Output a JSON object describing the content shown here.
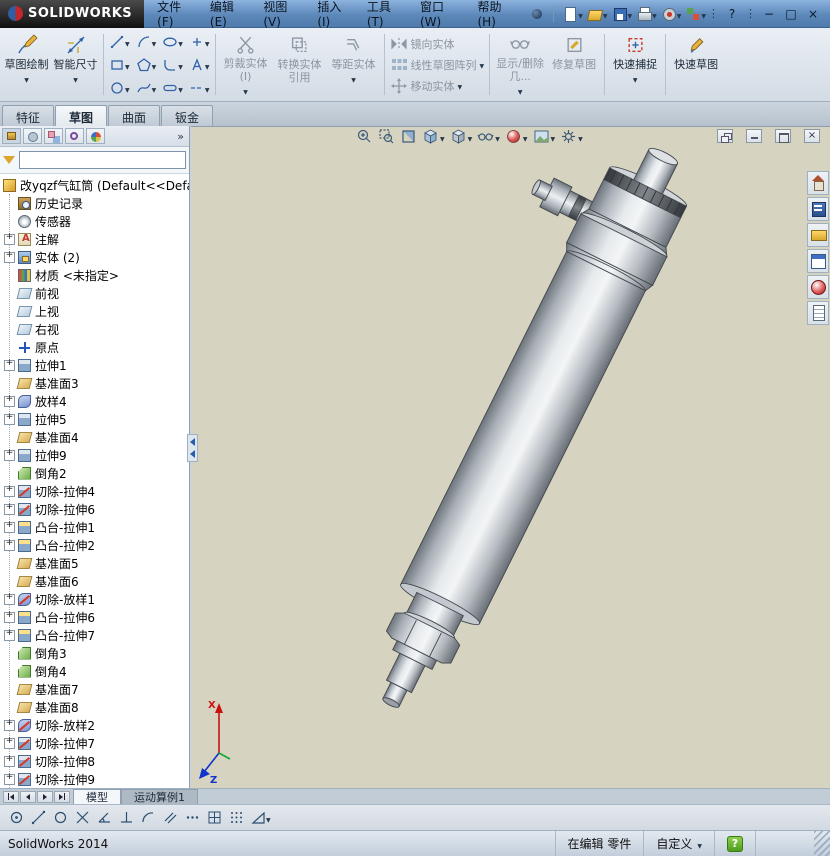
{
  "titlebar": {
    "brand": "SOLIDWORKS",
    "menus": [
      "文件(F)",
      "编辑(E)",
      "视图(V)",
      "插入(I)",
      "工具(T)",
      "窗口(W)",
      "帮助(H)"
    ]
  },
  "glyphs": {
    "down": "▼",
    "chevrons": "»",
    "plus": "+",
    "min": "−",
    "max": "□",
    "close": "×",
    "help": "?"
  },
  "ribbon": {
    "sketch": "草图绘制",
    "smart_dimension": "智能尺寸",
    "trim": "剪裁实体(I)",
    "convert": "转换实体引用",
    "offset": "等距实体",
    "mirror": "镜向实体",
    "linear_pattern": "线性草图阵列",
    "move": "移动实体",
    "display_delete": "显示/删除几...",
    "repair": "修复草图",
    "quick_snaps": "快速捕捉",
    "rapid_sketch": "快速草图"
  },
  "command_tabs": [
    "特征",
    "草图",
    "曲面",
    "钣金"
  ],
  "panel": {
    "filter_value": ""
  },
  "tree": {
    "root": "改yqzf气缸筒 (Default<<Defa",
    "items": [
      {
        "label": "历史记录",
        "icon": "history",
        "plus": false
      },
      {
        "label": "传感器",
        "icon": "sensors",
        "plus": false
      },
      {
        "label": "注解",
        "icon": "annotations",
        "plus": true
      },
      {
        "label": "实体 (2)",
        "icon": "solid-bodies",
        "plus": true
      },
      {
        "label": "材质 <未指定>",
        "icon": "material",
        "plus": false
      },
      {
        "label": "前视",
        "icon": "ref-plane",
        "plus": false
      },
      {
        "label": "上视",
        "icon": "ref-plane",
        "plus": false
      },
      {
        "label": "右视",
        "icon": "ref-plane",
        "plus": false
      },
      {
        "label": "原点",
        "icon": "origin",
        "plus": false
      },
      {
        "label": "拉伸1",
        "icon": "extrude",
        "plus": true
      },
      {
        "label": "基准面3",
        "icon": "plane",
        "plus": false
      },
      {
        "label": "放样4",
        "icon": "loft",
        "plus": true
      },
      {
        "label": "拉伸5",
        "icon": "extrude",
        "plus": true
      },
      {
        "label": "基准面4",
        "icon": "plane",
        "plus": false
      },
      {
        "label": "拉伸9",
        "icon": "extrude",
        "plus": true
      },
      {
        "label": "倒角2",
        "icon": "chamfer",
        "plus": false
      },
      {
        "label": "切除-拉伸4",
        "icon": "cut-extrude",
        "plus": true
      },
      {
        "label": "切除-拉伸6",
        "icon": "cut-extrude",
        "plus": true
      },
      {
        "label": "凸台-拉伸1",
        "icon": "boss-extrude",
        "plus": true
      },
      {
        "label": "凸台-拉伸2",
        "icon": "boss-extrude",
        "plus": true
      },
      {
        "label": "基准面5",
        "icon": "plane",
        "plus": false
      },
      {
        "label": "基准面6",
        "icon": "plane",
        "plus": false
      },
      {
        "label": "切除-放样1",
        "icon": "cut-loft",
        "plus": true
      },
      {
        "label": "凸台-拉伸6",
        "icon": "boss-extrude",
        "plus": true
      },
      {
        "label": "凸台-拉伸7",
        "icon": "boss-extrude",
        "plus": true
      },
      {
        "label": "倒角3",
        "icon": "chamfer",
        "plus": false
      },
      {
        "label": "倒角4",
        "icon": "chamfer",
        "plus": false
      },
      {
        "label": "基准面7",
        "icon": "plane",
        "plus": false
      },
      {
        "label": "基准面8",
        "icon": "plane",
        "plus": false
      },
      {
        "label": "切除-放样2",
        "icon": "cut-loft",
        "plus": true
      },
      {
        "label": "切除-拉伸7",
        "icon": "cut-extrude",
        "plus": true
      },
      {
        "label": "切除-拉伸8",
        "icon": "cut-extrude",
        "plus": true
      },
      {
        "label": "切除-拉伸9",
        "icon": "cut-extrude",
        "plus": true
      }
    ]
  },
  "viewport": {
    "triad": {
      "x": "X",
      "z": "Z"
    }
  },
  "bottom": {
    "model_tab": "模型",
    "motion_tab": "运动算例1"
  },
  "status": {
    "app": "SolidWorks 2014",
    "editing": "在编辑 零件",
    "custom": "自定义"
  },
  "icon_names": {
    "standard": [
      "search",
      "new-document",
      "open",
      "save",
      "print",
      "hole-wizard",
      "options"
    ],
    "hud": [
      "zoom-fit",
      "zoom-area",
      "section-view",
      "view-orientation",
      "display-style",
      "hide-show-items",
      "edit-appearance",
      "apply-scene",
      "view-settings"
    ],
    "taskpane": [
      "solidworks-resources",
      "design-library",
      "file-explorer",
      "view-palette",
      "appearances",
      "custom-properties"
    ],
    "snapbar": [
      "point-snap",
      "line-snap",
      "circle-snap",
      "intersection-snap",
      "angle-snap",
      "perpendicular-snap",
      "arc-snap",
      "parallel-snap",
      "midpoint-snap",
      "grid-snap",
      "grid-dots",
      "angle-filter"
    ]
  }
}
